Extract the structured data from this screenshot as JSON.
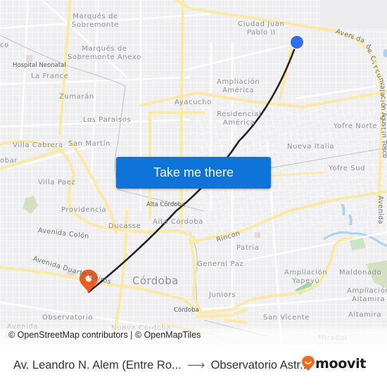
{
  "map": {
    "button_label": "Take me there",
    "attribution": "© OpenStreetMap contributors | © OpenMapTiles",
    "origin_marker_color": "#2d6ff0",
    "destination_marker_color": "#f05a1a",
    "route_line_color": "#222222",
    "neighborhoods": [
      {
        "id": "marques-sobremonte",
        "text": "Marqués de\nSobremonte"
      },
      {
        "id": "marques-sobremonte-anexo",
        "text": "Marqués de\nSobremonte Anexo"
      },
      {
        "id": "la-france",
        "text": "La France"
      },
      {
        "id": "zumaran",
        "text": "Zumarán"
      },
      {
        "id": "los-paraisos",
        "text": "Los Paraisos"
      },
      {
        "id": "villa-cabrera",
        "text": "Villa Cabrera"
      },
      {
        "id": "san-martin",
        "text": "San Martín"
      },
      {
        "id": "obar",
        "text": "obar"
      },
      {
        "id": "villa-paez",
        "text": "Villa Paez"
      },
      {
        "id": "providencia",
        "text": "Providencia"
      },
      {
        "id": "ducasse",
        "text": "Ducasse"
      },
      {
        "id": "alta-cordoba-2",
        "text": "Alta Córdoba"
      },
      {
        "id": "co",
        "text": "co"
      },
      {
        "id": "ciudad-juan-pablo",
        "text": "Ciudad Juan\nPablo II"
      },
      {
        "id": "ampliacion-america",
        "text": "Ampliación\nAmérica"
      },
      {
        "id": "ayacucho",
        "text": "Ayacucho"
      },
      {
        "id": "residencial-america",
        "text": "Residencial\nAmérica"
      },
      {
        "id": "yofre-norte",
        "text": "Yofre Norte"
      },
      {
        "id": "nueva-italia",
        "text": "Nueva Italia"
      },
      {
        "id": "yofre-sud",
        "text": "Yofre Sud"
      },
      {
        "id": "patria",
        "text": "Patria"
      },
      {
        "id": "general-paz",
        "text": "General Paz"
      },
      {
        "id": "ampliacion-yapeyu",
        "text": "Ampliación\nYapeyú"
      },
      {
        "id": "maldonado",
        "text": "Maldonado"
      },
      {
        "id": "ampliacion-altamira",
        "text": "Ampliación\nAltamira"
      },
      {
        "id": "altamira",
        "text": "Altamira"
      },
      {
        "id": "juniors",
        "text": "Juniors"
      },
      {
        "id": "san-vicente",
        "text": "San Vicente"
      },
      {
        "id": "mirador",
        "text": "Mirador"
      },
      {
        "id": "observatorio",
        "text": "Observatorio"
      },
      {
        "id": "nueva-cordoba",
        "text": "Nueva Córdoba"
      },
      {
        "id": "avenida-sw",
        "text": "Avenida"
      }
    ],
    "pois": [
      {
        "id": "hospital-neonatal",
        "text": "Hospital Neonatal"
      },
      {
        "id": "alta-cordoba-station",
        "text": "Alta Córdoba"
      },
      {
        "id": "cordoba-station",
        "text": "Córdoba"
      }
    ],
    "city": "Córdoba",
    "roads": [
      {
        "id": "avenida-colon",
        "text": "Avenida Colón"
      },
      {
        "id": "avenida-duarte-quiros",
        "text": "Avenida Duarte Quirós"
      },
      {
        "id": "rincon",
        "text": "Rincon"
      },
      {
        "id": "circunvalacion",
        "text": "Avenida de Circunvalación Agustín Tosco"
      },
      {
        "id": "avenida-east",
        "text": "Avenida"
      }
    ]
  },
  "footer": {
    "origin": "Av. Leandro N. Alem (Entre Ro...",
    "arrow": "⟶",
    "destination": "Observatorio Astr...",
    "brand": "moovit",
    "brand_color": "#f26b1d"
  }
}
